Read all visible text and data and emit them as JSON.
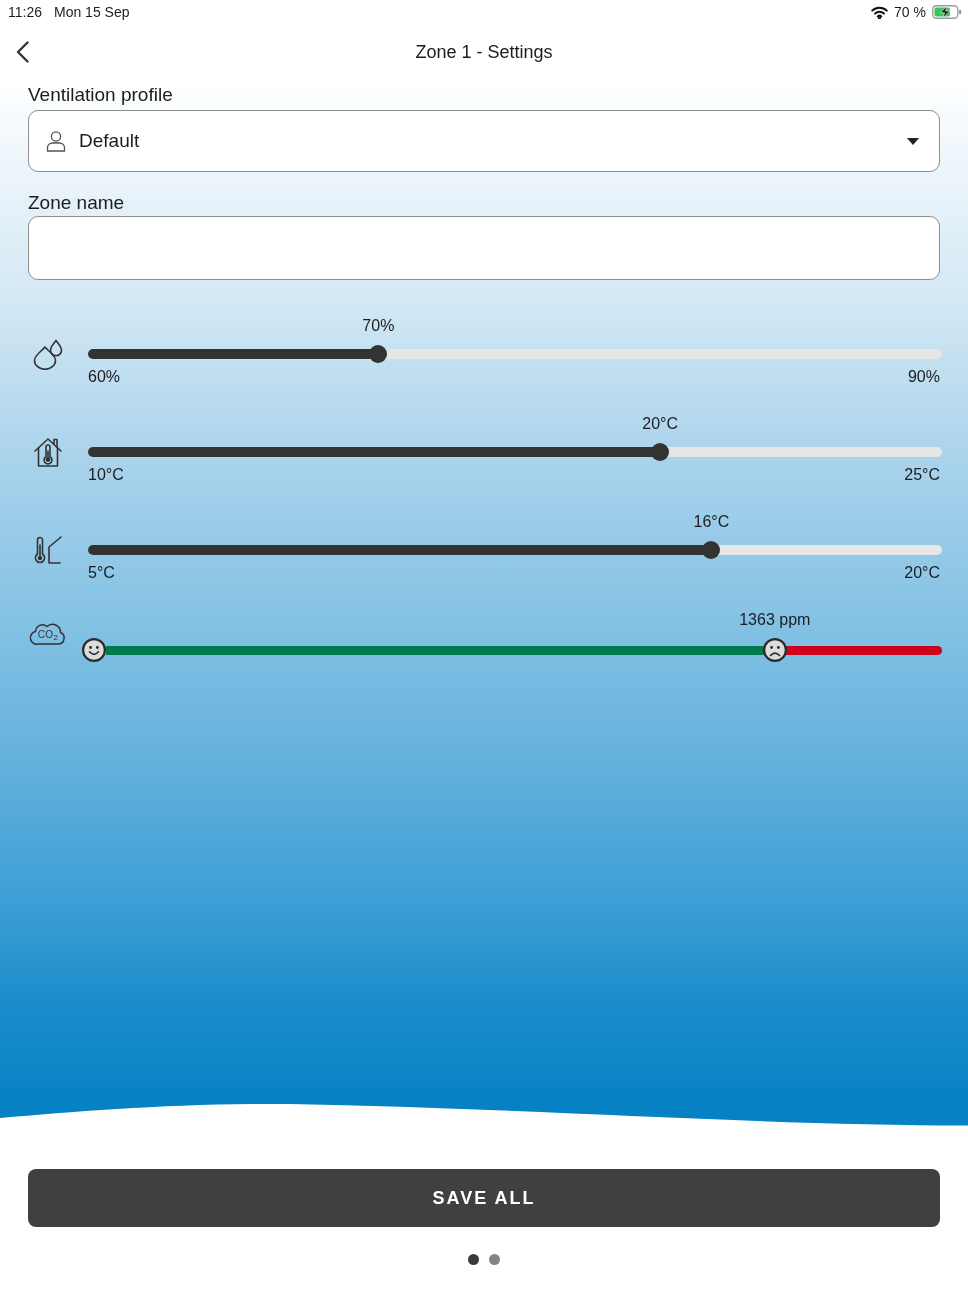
{
  "status_bar": {
    "time": "11:26",
    "date": "Mon 15 Sep",
    "battery_percent": "70 %"
  },
  "nav": {
    "title": "Zone 1 - Settings"
  },
  "profile": {
    "label": "Ventilation profile",
    "value": "Default"
  },
  "zone_name": {
    "label": "Zone name"
  },
  "sliders": [
    {
      "kind": "humidity",
      "value": "70%",
      "min": "60%",
      "max": "90%",
      "level": 0.34
    },
    {
      "kind": "indoor_temperature",
      "value": "20°C",
      "min": "10°C",
      "max": "25°C",
      "level": 0.67
    },
    {
      "kind": "outdoor_temperature",
      "value": "16°C",
      "min": "5°C",
      "max": "20°C",
      "level": 0.73
    },
    {
      "kind": "co2",
      "icon_label": "CO$_{2}$",
      "value": "1363 ppm",
      "level": 0.8
    }
  ],
  "save_button": {
    "label": "SAVE ALL"
  },
  "pages": [
    {
      "selected": true
    },
    {
      "selected": false
    }
  ]
}
